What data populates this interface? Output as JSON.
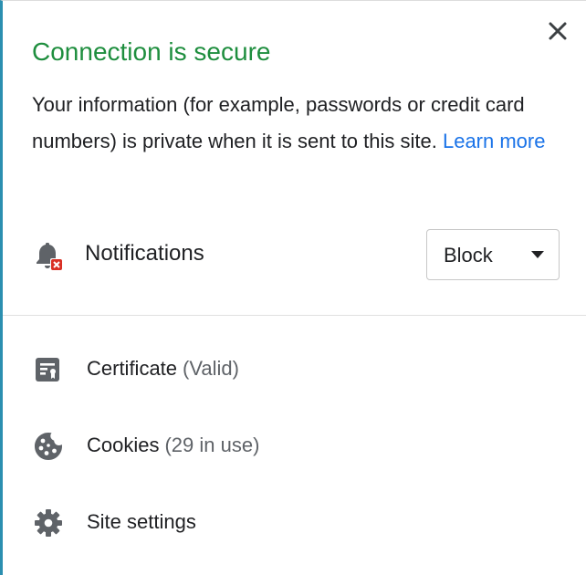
{
  "header": {
    "title": "Connection is secure",
    "close_icon": "close-icon"
  },
  "description": {
    "text": "Your information (for example, passwords or credit card numbers) is private when it is sent to this site. ",
    "link": "Learn more"
  },
  "permissions": {
    "notifications": {
      "label": "Notifications",
      "icon": "notifications-blocked-icon",
      "value": "Block"
    }
  },
  "menu": {
    "certificate": {
      "label": "Certificate",
      "detail": "(Valid)",
      "icon": "certificate-icon"
    },
    "cookies": {
      "label": "Cookies",
      "detail": "(29 in use)",
      "icon": "cookie-icon"
    },
    "site_settings": {
      "label": "Site settings",
      "icon": "gear-icon"
    }
  },
  "colors": {
    "secure_title": "#1e8e3e",
    "link": "#1a73e8",
    "icon_gray": "#5f6368",
    "blocked_badge": "#d93025"
  }
}
